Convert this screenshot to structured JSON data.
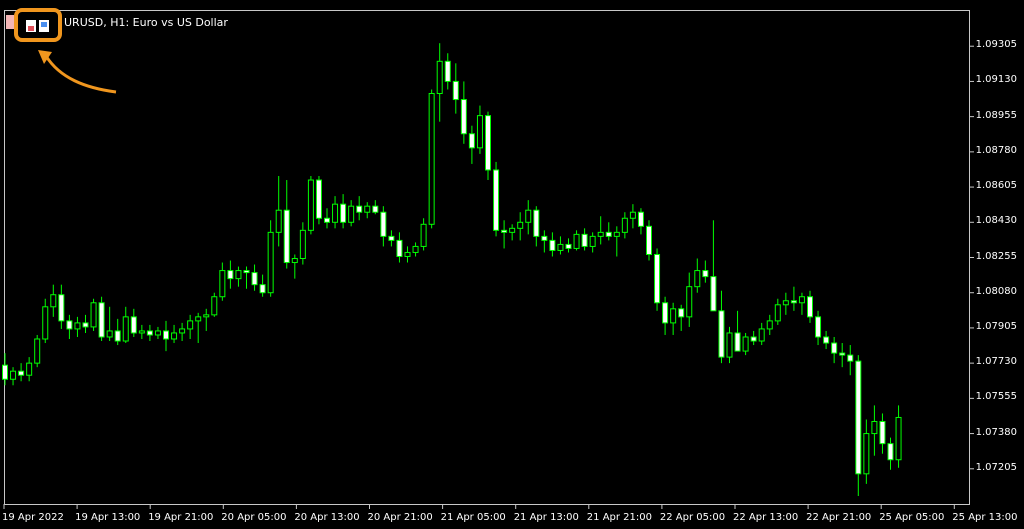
{
  "window": {
    "title": "URUSD, H1:  Euro vs US Dollar"
  },
  "toolbar": {
    "icon_name": "chart-one-click-trading-icon",
    "accent_color": "#f0961e"
  },
  "chart_data": {
    "type": "candlestick",
    "symbol": "EURUSD",
    "timeframe": "H1",
    "description": "Euro vs US Dollar",
    "ylim": [
      1.0703,
      1.0948
    ],
    "y_ticks": [
      "1.09305",
      "1.09130",
      "1.08955",
      "1.08780",
      "1.08605",
      "1.08430",
      "1.08255",
      "1.08080",
      "1.07905",
      "1.07730",
      "1.07555",
      "1.07380",
      "1.07205"
    ],
    "x_ticks": [
      "19 Apr 2022",
      "19 Apr 13:00",
      "19 Apr 21:00",
      "20 Apr 05:00",
      "20 Apr 13:00",
      "20 Apr 21:00",
      "21 Apr 05:00",
      "21 Apr 13:00",
      "21 Apr 21:00",
      "22 Apr 05:00",
      "22 Apr 13:00",
      "22 Apr 21:00",
      "25 Apr 05:00",
      "25 Apr 13:00"
    ],
    "colors": {
      "bull_body": "#000000",
      "bear_body": "#ffffff",
      "wick": "#00ff00",
      "background": "#000000",
      "axis_text": "#ffffff"
    },
    "candles": [
      {
        "o": 1.0772,
        "h": 1.0778,
        "l": 1.0762,
        "c": 1.0765
      },
      {
        "o": 1.0765,
        "h": 1.0771,
        "l": 1.0762,
        "c": 1.0769
      },
      {
        "o": 1.0769,
        "h": 1.0773,
        "l": 1.0764,
        "c": 1.0767
      },
      {
        "o": 1.0767,
        "h": 1.0776,
        "l": 1.0764,
        "c": 1.0773
      },
      {
        "o": 1.0773,
        "h": 1.0787,
        "l": 1.0771,
        "c": 1.0785
      },
      {
        "o": 1.0785,
        "h": 1.0805,
        "l": 1.0783,
        "c": 1.0801
      },
      {
        "o": 1.0801,
        "h": 1.0812,
        "l": 1.0796,
        "c": 1.0807
      },
      {
        "o": 1.0807,
        "h": 1.0812,
        "l": 1.079,
        "c": 1.0794
      },
      {
        "o": 1.0794,
        "h": 1.0797,
        "l": 1.0785,
        "c": 1.079
      },
      {
        "o": 1.079,
        "h": 1.0796,
        "l": 1.0786,
        "c": 1.0793
      },
      {
        "o": 1.0793,
        "h": 1.0797,
        "l": 1.0788,
        "c": 1.0791
      },
      {
        "o": 1.0791,
        "h": 1.0805,
        "l": 1.0789,
        "c": 1.0803
      },
      {
        "o": 1.0803,
        "h": 1.0806,
        "l": 1.0784,
        "c": 1.0786
      },
      {
        "o": 1.0786,
        "h": 1.0801,
        "l": 1.0784,
        "c": 1.0789
      },
      {
        "o": 1.0789,
        "h": 1.0795,
        "l": 1.0782,
        "c": 1.0784
      },
      {
        "o": 1.0784,
        "h": 1.0801,
        "l": 1.0783,
        "c": 1.0796
      },
      {
        "o": 1.0796,
        "h": 1.08,
        "l": 1.0786,
        "c": 1.0788
      },
      {
        "o": 1.0788,
        "h": 1.0792,
        "l": 1.0785,
        "c": 1.0789
      },
      {
        "o": 1.0789,
        "h": 1.0792,
        "l": 1.0784,
        "c": 1.0787
      },
      {
        "o": 1.0787,
        "h": 1.0791,
        "l": 1.0785,
        "c": 1.0789
      },
      {
        "o": 1.0789,
        "h": 1.0794,
        "l": 1.0779,
        "c": 1.0785
      },
      {
        "o": 1.0785,
        "h": 1.0792,
        "l": 1.0783,
        "c": 1.0788
      },
      {
        "o": 1.0788,
        "h": 1.0793,
        "l": 1.0784,
        "c": 1.079
      },
      {
        "o": 1.079,
        "h": 1.0797,
        "l": 1.0785,
        "c": 1.0794
      },
      {
        "o": 1.0794,
        "h": 1.0798,
        "l": 1.0783,
        "c": 1.0796
      },
      {
        "o": 1.0796,
        "h": 1.08,
        "l": 1.0789,
        "c": 1.0797
      },
      {
        "o": 1.0797,
        "h": 1.0808,
        "l": 1.0796,
        "c": 1.0806
      },
      {
        "o": 1.0806,
        "h": 1.0823,
        "l": 1.0804,
        "c": 1.0819
      },
      {
        "o": 1.0819,
        "h": 1.0824,
        "l": 1.081,
        "c": 1.0815
      },
      {
        "o": 1.0815,
        "h": 1.0821,
        "l": 1.0811,
        "c": 1.0819
      },
      {
        "o": 1.0819,
        "h": 1.0821,
        "l": 1.081,
        "c": 1.0818
      },
      {
        "o": 1.0818,
        "h": 1.0822,
        "l": 1.0809,
        "c": 1.0812
      },
      {
        "o": 1.0812,
        "h": 1.0817,
        "l": 1.0806,
        "c": 1.0808
      },
      {
        "o": 1.0808,
        "h": 1.0844,
        "l": 1.0806,
        "c": 1.0838
      },
      {
        "o": 1.0838,
        "h": 1.0866,
        "l": 1.0831,
        "c": 1.0849
      },
      {
        "o": 1.0849,
        "h": 1.0864,
        "l": 1.082,
        "c": 1.0823
      },
      {
        "o": 1.0823,
        "h": 1.0827,
        "l": 1.0815,
        "c": 1.0825
      },
      {
        "o": 1.0825,
        "h": 1.0843,
        "l": 1.0822,
        "c": 1.0839
      },
      {
        "o": 1.0839,
        "h": 1.0866,
        "l": 1.0837,
        "c": 1.0864
      },
      {
        "o": 1.0864,
        "h": 1.0866,
        "l": 1.0842,
        "c": 1.0845
      },
      {
        "o": 1.0845,
        "h": 1.085,
        "l": 1.084,
        "c": 1.0843
      },
      {
        "o": 1.0843,
        "h": 1.0856,
        "l": 1.084,
        "c": 1.0852
      },
      {
        "o": 1.0852,
        "h": 1.0857,
        "l": 1.084,
        "c": 1.0843
      },
      {
        "o": 1.0843,
        "h": 1.0854,
        "l": 1.0841,
        "c": 1.0851
      },
      {
        "o": 1.0851,
        "h": 1.0856,
        "l": 1.0844,
        "c": 1.0848
      },
      {
        "o": 1.0848,
        "h": 1.0853,
        "l": 1.0845,
        "c": 1.0851
      },
      {
        "o": 1.0851,
        "h": 1.0854,
        "l": 1.0847,
        "c": 1.0848
      },
      {
        "o": 1.0848,
        "h": 1.0851,
        "l": 1.0831,
        "c": 1.0836
      },
      {
        "o": 1.0836,
        "h": 1.0839,
        "l": 1.0831,
        "c": 1.0834
      },
      {
        "o": 1.0834,
        "h": 1.0838,
        "l": 1.0823,
        "c": 1.0826
      },
      {
        "o": 1.0826,
        "h": 1.0831,
        "l": 1.0823,
        "c": 1.0828
      },
      {
        "o": 1.0828,
        "h": 1.0833,
        "l": 1.0826,
        "c": 1.0831
      },
      {
        "o": 1.0831,
        "h": 1.0845,
        "l": 1.0829,
        "c": 1.0842
      },
      {
        "o": 1.0842,
        "h": 1.0909,
        "l": 1.084,
        "c": 1.0907
      },
      {
        "o": 1.0907,
        "h": 1.0932,
        "l": 1.0893,
        "c": 1.0923
      },
      {
        "o": 1.0923,
        "h": 1.0927,
        "l": 1.0909,
        "c": 1.0913
      },
      {
        "o": 1.0913,
        "h": 1.0922,
        "l": 1.0897,
        "c": 1.0904
      },
      {
        "o": 1.0904,
        "h": 1.0913,
        "l": 1.0882,
        "c": 1.0887
      },
      {
        "o": 1.0887,
        "h": 1.0891,
        "l": 1.0872,
        "c": 1.088
      },
      {
        "o": 1.088,
        "h": 1.0901,
        "l": 1.0877,
        "c": 1.0896
      },
      {
        "o": 1.0896,
        "h": 1.0898,
        "l": 1.0864,
        "c": 1.0869
      },
      {
        "o": 1.0869,
        "h": 1.0873,
        "l": 1.0836,
        "c": 1.0839
      },
      {
        "o": 1.0839,
        "h": 1.0844,
        "l": 1.083,
        "c": 1.0838
      },
      {
        "o": 1.0838,
        "h": 1.0842,
        "l": 1.0834,
        "c": 1.084
      },
      {
        "o": 1.084,
        "h": 1.0848,
        "l": 1.0834,
        "c": 1.0843
      },
      {
        "o": 1.0843,
        "h": 1.0854,
        "l": 1.0837,
        "c": 1.0849
      },
      {
        "o": 1.0849,
        "h": 1.0851,
        "l": 1.0831,
        "c": 1.0836
      },
      {
        "o": 1.0836,
        "h": 1.0839,
        "l": 1.0828,
        "c": 1.0834
      },
      {
        "o": 1.0834,
        "h": 1.0838,
        "l": 1.0826,
        "c": 1.0829
      },
      {
        "o": 1.0829,
        "h": 1.0836,
        "l": 1.0827,
        "c": 1.0832
      },
      {
        "o": 1.0832,
        "h": 1.0835,
        "l": 1.0828,
        "c": 1.083
      },
      {
        "o": 1.083,
        "h": 1.0839,
        "l": 1.0829,
        "c": 1.0837
      },
      {
        "o": 1.0837,
        "h": 1.084,
        "l": 1.0829,
        "c": 1.0831
      },
      {
        "o": 1.0831,
        "h": 1.0838,
        "l": 1.0828,
        "c": 1.0836
      },
      {
        "o": 1.0836,
        "h": 1.0846,
        "l": 1.0832,
        "c": 1.0838
      },
      {
        "o": 1.0838,
        "h": 1.0843,
        "l": 1.0834,
        "c": 1.0836
      },
      {
        "o": 1.0836,
        "h": 1.0841,
        "l": 1.0826,
        "c": 1.0838
      },
      {
        "o": 1.0838,
        "h": 1.0848,
        "l": 1.0835,
        "c": 1.0845
      },
      {
        "o": 1.0845,
        "h": 1.0852,
        "l": 1.084,
        "c": 1.0848
      },
      {
        "o": 1.0848,
        "h": 1.085,
        "l": 1.0837,
        "c": 1.0841
      },
      {
        "o": 1.0841,
        "h": 1.0844,
        "l": 1.0824,
        "c": 1.0827
      },
      {
        "o": 1.0827,
        "h": 1.083,
        "l": 1.0799,
        "c": 1.0803
      },
      {
        "o": 1.0803,
        "h": 1.0806,
        "l": 1.0787,
        "c": 1.0793
      },
      {
        "o": 1.0793,
        "h": 1.0803,
        "l": 1.0787,
        "c": 1.08
      },
      {
        "o": 1.08,
        "h": 1.0802,
        "l": 1.0789,
        "c": 1.0796
      },
      {
        "o": 1.0796,
        "h": 1.0818,
        "l": 1.0791,
        "c": 1.0811
      },
      {
        "o": 1.0811,
        "h": 1.0825,
        "l": 1.0808,
        "c": 1.0819
      },
      {
        "o": 1.0819,
        "h": 1.0824,
        "l": 1.0813,
        "c": 1.0816
      },
      {
        "o": 1.0816,
        "h": 1.0844,
        "l": 1.0813,
        "c": 1.0799
      },
      {
        "o": 1.0799,
        "h": 1.0809,
        "l": 1.0773,
        "c": 1.0776
      },
      {
        "o": 1.0776,
        "h": 1.0791,
        "l": 1.0773,
        "c": 1.0788
      },
      {
        "o": 1.0788,
        "h": 1.0799,
        "l": 1.078,
        "c": 1.0779
      },
      {
        "o": 1.0779,
        "h": 1.0788,
        "l": 1.0777,
        "c": 1.0786
      },
      {
        "o": 1.0786,
        "h": 1.0789,
        "l": 1.0782,
        "c": 1.0784
      },
      {
        "o": 1.0784,
        "h": 1.0793,
        "l": 1.0782,
        "c": 1.079
      },
      {
        "o": 1.079,
        "h": 1.0797,
        "l": 1.0787,
        "c": 1.0794
      },
      {
        "o": 1.0794,
        "h": 1.0805,
        "l": 1.0792,
        "c": 1.0802
      },
      {
        "o": 1.0802,
        "h": 1.0808,
        "l": 1.0797,
        "c": 1.0804
      },
      {
        "o": 1.0804,
        "h": 1.0811,
        "l": 1.0799,
        "c": 1.0803
      },
      {
        "o": 1.0803,
        "h": 1.0808,
        "l": 1.0797,
        "c": 1.0806
      },
      {
        "o": 1.0806,
        "h": 1.0809,
        "l": 1.0793,
        "c": 1.0796
      },
      {
        "o": 1.0796,
        "h": 1.0799,
        "l": 1.0782,
        "c": 1.0786
      },
      {
        "o": 1.0786,
        "h": 1.0789,
        "l": 1.078,
        "c": 1.0783
      },
      {
        "o": 1.0783,
        "h": 1.0786,
        "l": 1.0773,
        "c": 1.0778
      },
      {
        "o": 1.0778,
        "h": 1.0783,
        "l": 1.0771,
        "c": 1.0777
      },
      {
        "o": 1.0777,
        "h": 1.0782,
        "l": 1.0767,
        "c": 1.0774
      },
      {
        "o": 1.0774,
        "h": 1.0777,
        "l": 1.0707,
        "c": 1.0718
      },
      {
        "o": 1.0718,
        "h": 1.0745,
        "l": 1.0713,
        "c": 1.0738
      },
      {
        "o": 1.0738,
        "h": 1.0752,
        "l": 1.0727,
        "c": 1.0744
      },
      {
        "o": 1.0744,
        "h": 1.0748,
        "l": 1.0728,
        "c": 1.0733
      },
      {
        "o": 1.0733,
        "h": 1.0736,
        "l": 1.072,
        "c": 1.0725
      },
      {
        "o": 1.0725,
        "h": 1.0752,
        "l": 1.0721,
        "c": 1.0746
      }
    ]
  }
}
